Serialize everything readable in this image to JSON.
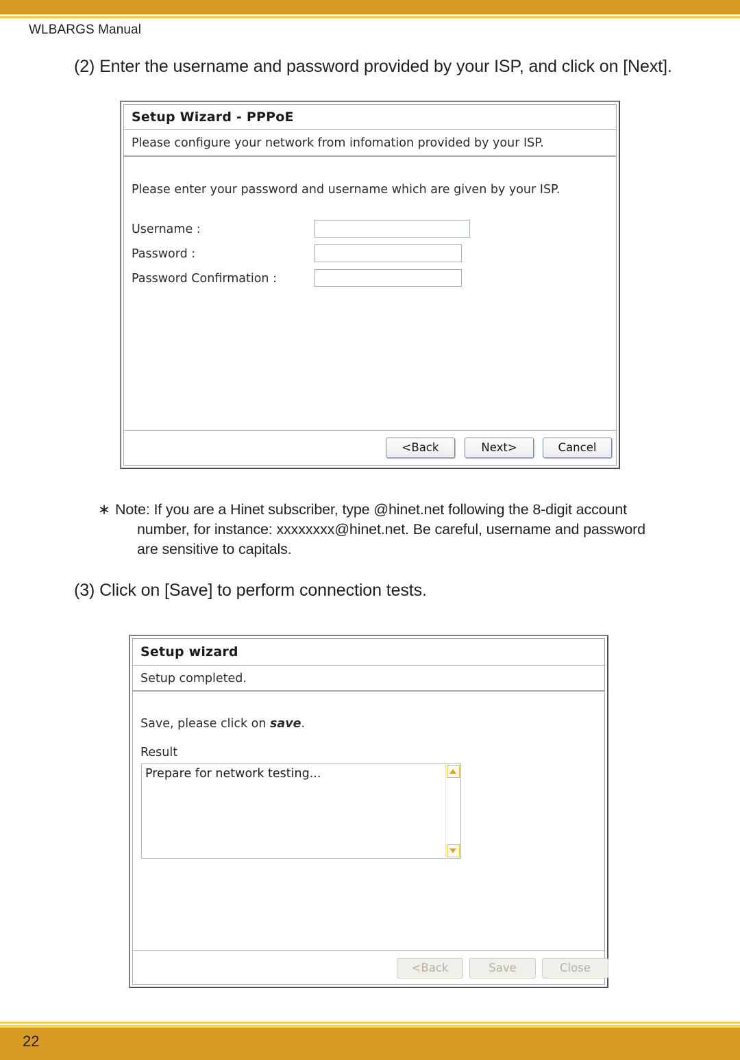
{
  "document": {
    "running_head": "WLBARGS Manual",
    "page_number": "22",
    "accent_color": "#d79a25",
    "rule_color": "#f2d24f"
  },
  "steps": {
    "step_two": "(2) Enter the username and password provided by your ISP, and click on [Next].",
    "step_three": "(3) Click on [Save] to perform connection tests."
  },
  "note": {
    "marker": "∗",
    "line_one": "Note: If you are a Hinet subscriber, type @hinet.net following the 8-digit account",
    "line_two": "number, for instance: xxxxxxxx@hinet.net. Be careful, username and password",
    "line_three": "are sensitive to capitals."
  },
  "dialog_pppoe": {
    "title": "Setup Wizard - PPPoE",
    "subtitle": "Please configure your network from infomation provided by your ISP.",
    "intro": "Please enter your password and username which are given by your ISP.",
    "fields": [
      {
        "label": "Username :",
        "value": "",
        "placeholder": ""
      },
      {
        "label": "Password :",
        "value": "",
        "placeholder": ""
      },
      {
        "label": "Password Confirmation :",
        "value": "",
        "placeholder": ""
      }
    ],
    "buttons": {
      "back": "<Back",
      "next": "Next>",
      "cancel": "Cancel"
    }
  },
  "dialog_setup_wizard": {
    "title": "Setup wizard",
    "subtitle": "Setup completed.",
    "hint_prefix": "Save, please click on ",
    "hint_emphasis": "save",
    "hint_suffix": ".",
    "result_label": "Result",
    "result_text": "Prepare for network testing...",
    "scrollbar": {
      "up_icon": "scroll-up-arrow-icon",
      "down_icon": "scroll-down-arrow-icon",
      "arrow_color": "#e8a21c",
      "border_color": "#f0c419"
    },
    "buttons": {
      "back": "<Back",
      "save": "Save",
      "close": "Close"
    }
  }
}
